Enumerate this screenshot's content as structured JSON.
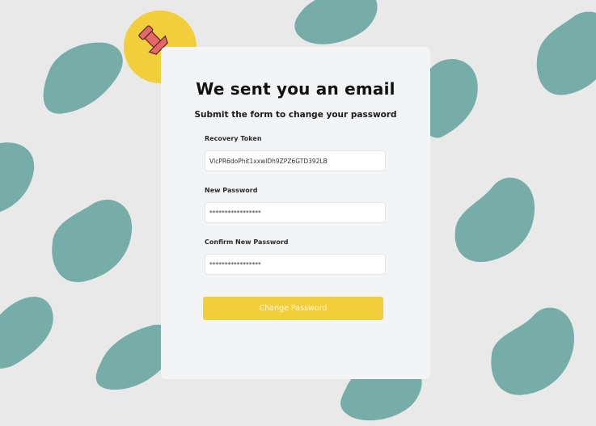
{
  "colors": {
    "background": "#e9e9e9",
    "blob": "#76ada8",
    "card": "#f3f4f6",
    "accent_yellow": "#f2cf3a",
    "pin_red": "#e8666a"
  },
  "badge": {
    "icon": "pushpin-icon"
  },
  "card": {
    "title": "We sent you an email",
    "subtitle": "Submit the form to change your password"
  },
  "form": {
    "recovery_token": {
      "label": "Recovery Token",
      "value": "VlcPR6doPhit1xxwlDh9ZPZ6GTD392LB"
    },
    "new_password": {
      "label": "New Password",
      "value": "*****************"
    },
    "confirm_password": {
      "label": "Confirm New Password",
      "value": "*****************"
    },
    "submit_label": "Change Password"
  }
}
